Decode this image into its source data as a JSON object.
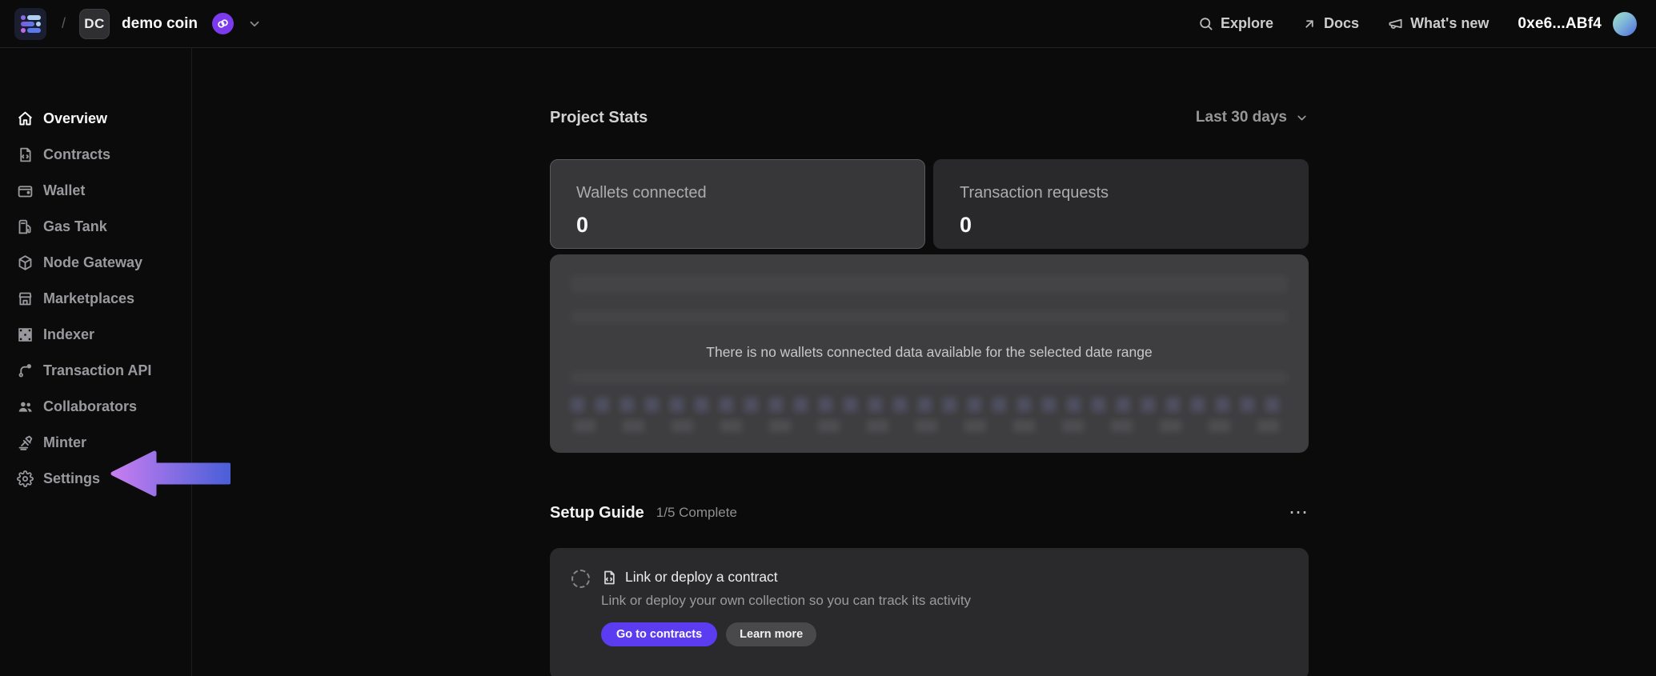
{
  "topbar": {
    "separator": "/",
    "team_badge": "DC",
    "project_name": "demo coin",
    "nav": [
      {
        "label": "Explore",
        "icon": "search-icon"
      },
      {
        "label": "Docs",
        "icon": "arrow-up-right-icon"
      },
      {
        "label": "What's new",
        "icon": "megaphone-icon"
      }
    ],
    "wallet_address": "0xe6...ABf4",
    "icons": {
      "logo": "app-logo",
      "chain_badge": "loop-badge-icon",
      "project_menu": "chevron-down-icon",
      "avatar": "account-avatar"
    }
  },
  "sidebar": {
    "items": [
      {
        "label": "Overview",
        "icon": "home-icon",
        "active": true
      },
      {
        "label": "Contracts",
        "icon": "contract-icon"
      },
      {
        "label": "Wallet",
        "icon": "wallet-icon"
      },
      {
        "label": "Gas Tank",
        "icon": "fuel-pump-icon"
      },
      {
        "label": "Node Gateway",
        "icon": "cube-icon"
      },
      {
        "label": "Marketplaces",
        "icon": "storefront-icon"
      },
      {
        "label": "Indexer",
        "icon": "grid-icon"
      },
      {
        "label": "Transaction API",
        "icon": "route-icon"
      },
      {
        "label": "Collaborators",
        "icon": "people-icon"
      },
      {
        "label": "Minter",
        "icon": "gavel-icon"
      },
      {
        "label": "Settings",
        "icon": "gear-icon"
      }
    ],
    "annotation_arrow": {
      "points_at": "Settings",
      "gradient": [
        "#c77df0",
        "#4a5fd8"
      ]
    }
  },
  "project_stats": {
    "title": "Project Stats",
    "date_range": "Last 30 days",
    "cards": [
      {
        "label": "Wallets connected",
        "value": "0",
        "selected": true
      },
      {
        "label": "Transaction requests",
        "value": "0",
        "selected": false
      }
    ],
    "empty_message": "There is no wallets connected data available for the selected date range"
  },
  "setup_guide": {
    "title": "Setup Guide",
    "progress": "1/5 Complete",
    "overflow_menu": "⋯",
    "step": {
      "title": "Link or deploy a contract",
      "description": "Link or deploy your own collection so you can track its activity",
      "primary_button": "Go to contracts",
      "secondary_button": "Learn more"
    }
  },
  "colors": {
    "background": "#0b0b0c",
    "chart_card": "#3e3e40",
    "stat_card_selected": "#373739",
    "stat_card": "#29292b",
    "setup_card": "#2a2a2c",
    "accent_purple": "#5b3cf0",
    "badge_purple": "#7c3aed",
    "avatar_gradient": [
      "#a5e3c6",
      "#4f6bdd"
    ]
  }
}
